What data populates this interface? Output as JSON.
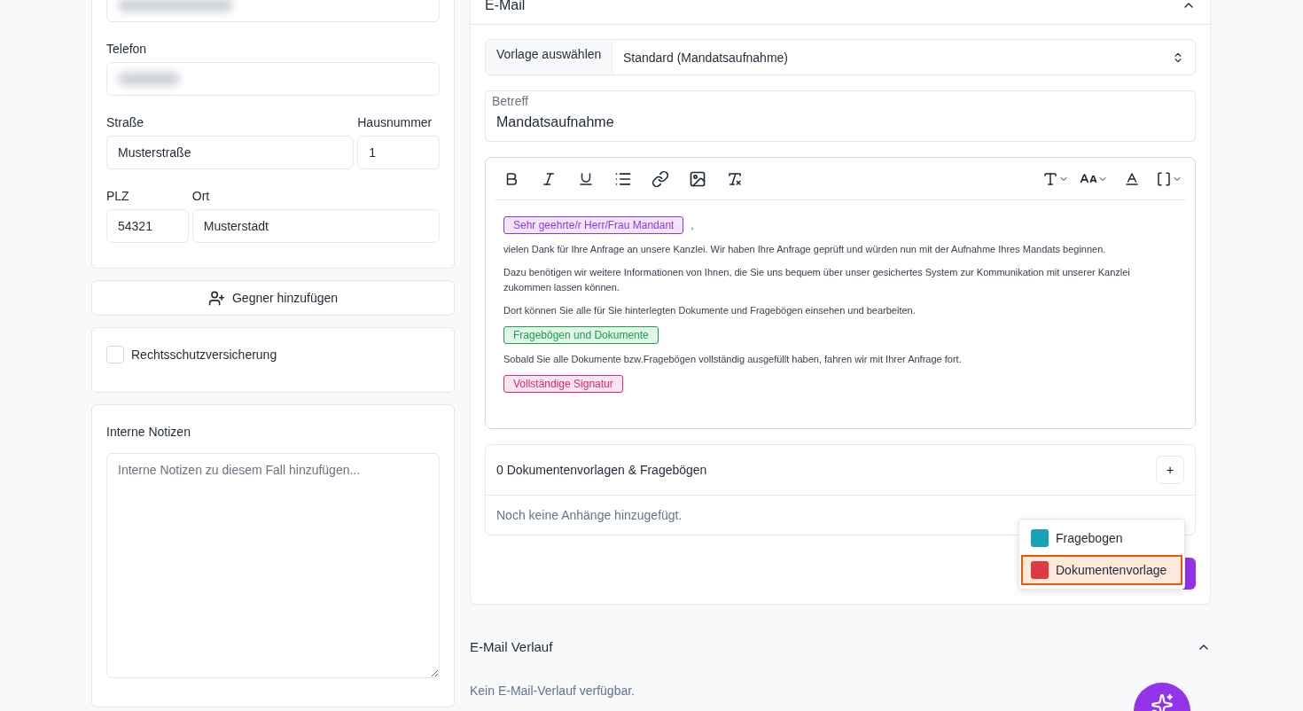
{
  "contact": {
    "email_field": {
      "redacted": true
    },
    "phone": {
      "label": "Telefon",
      "redacted": true
    },
    "street": {
      "label": "Straße",
      "value": "Musterstraße"
    },
    "house_number": {
      "label": "Hausnummer",
      "value": "1"
    },
    "zip": {
      "label": "PLZ",
      "value": "54321"
    },
    "city": {
      "label": "Ort",
      "value": "Musterstadt"
    }
  },
  "add_opponent_button": "Gegner hinzufügen",
  "legal_insurance": {
    "label": "Rechtsschutzversicherung",
    "checked": false
  },
  "notes": {
    "label": "Interne Notizen",
    "placeholder": "Interne Notizen zu diesem Fall hinzufügen..."
  },
  "email": {
    "title": "E-Mail",
    "template": {
      "label": "Vorlage auswählen",
      "value": "Standard (Mandatsaufnahme)"
    },
    "subject": {
      "label": "Betreff",
      "value": "Mandatsaufnahme"
    },
    "body": [
      {
        "kind": "tag",
        "text": "Sehr geehrte/r Herr/Frau Mandant",
        "color": "#9333ea",
        "after": ","
      },
      {
        "kind": "text",
        "text": "vielen Dank für Ihre Anfrage an unsere Kanzlei. Wir haben Ihre Anfrage geprüft und würden nun mit der Aufnahme Ihres Mandats beginnen."
      },
      {
        "kind": "text",
        "text": "Dazu benötigen wir weitere Informationen von Ihnen, die Sie uns bequem über unser gesichertes System zur Kommunikation mit unserer Kanzlei zukommen lassen können."
      },
      {
        "kind": "text",
        "text": "Dort können Sie alle für Sie hinterlegten Dokumente und Fragebögen einsehen und bearbeiten."
      },
      {
        "kind": "tag",
        "text": "Fragebögen und Dokumente",
        "color": "#16a34a"
      },
      {
        "kind": "text",
        "text": "Sobald Sie alle Dokumente bzw.Fragebögen vollständig ausgefüllt haben, fahren wir mit Ihrer Anfrage fort."
      },
      {
        "kind": "tag",
        "text": "Vollständige Signatur",
        "color": "#db2777"
      }
    ],
    "attachments": {
      "title": "0 Dokumentenvorlagen & Fragebögen",
      "add": "+",
      "empty": "Noch keine Anhänge hinzugefügt."
    },
    "menu": [
      {
        "label": "Fragebogen",
        "color": "#17a2b8",
        "selected": false
      },
      {
        "label": "Dokumentenvorlage",
        "color": "#e03a3e",
        "selected": true
      }
    ]
  },
  "history": {
    "title": "E-Mail Verlauf",
    "expanded": true,
    "empty": "Kein E-Mail-Verlauf verfügbar."
  }
}
